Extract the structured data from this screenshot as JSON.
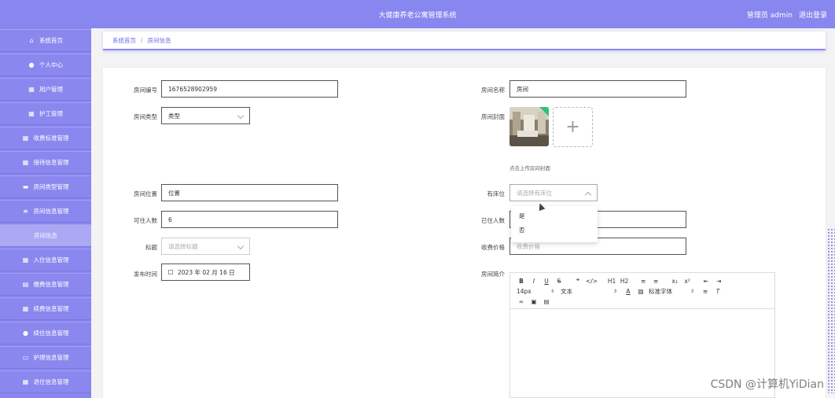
{
  "app": {
    "title": "大健康养老公寓管理系统",
    "user_label": "管理员 admin",
    "logout_label": "退出登录"
  },
  "sidebar": {
    "items": [
      {
        "label": "系统首页",
        "icon": "home-icon"
      },
      {
        "label": "个人中心",
        "icon": "user-icon"
      },
      {
        "label": "用户管理",
        "icon": "grid-icon"
      },
      {
        "label": "护工管理",
        "icon": "grid-icon"
      },
      {
        "label": "收费标准管理",
        "icon": "grid-icon"
      },
      {
        "label": "接待信息管理",
        "icon": "grid-icon"
      },
      {
        "label": "房间类型管理",
        "icon": "bag-icon"
      },
      {
        "label": "房间信息管理",
        "icon": "list-icon"
      },
      {
        "label": "房间信息",
        "icon": ""
      },
      {
        "label": "入住信息管理",
        "icon": "grid-icon"
      },
      {
        "label": "缴费信息管理",
        "icon": "table-icon"
      },
      {
        "label": "续费信息管理",
        "icon": "grid-icon"
      },
      {
        "label": "续住信息管理",
        "icon": "user-icon"
      },
      {
        "label": "护理信息管理",
        "icon": "monitor-icon"
      },
      {
        "label": "退住信息管理",
        "icon": "grid-icon"
      }
    ]
  },
  "breadcrumb": {
    "home": "系统首页",
    "separator": "/",
    "current": "房间信息"
  },
  "form": {
    "room_no": {
      "label": "房间编号",
      "value": "1676528902959"
    },
    "room_name": {
      "label": "房间名称",
      "value": "房间"
    },
    "room_type": {
      "label": "房间类型",
      "value": "类型"
    },
    "cover": {
      "label": "房间封面",
      "hint": "点击上传房间封面"
    },
    "location": {
      "label": "房间位置",
      "value": "位置"
    },
    "has_bed": {
      "label": "有床位",
      "placeholder": "请选择有床位",
      "options": [
        "是",
        "否"
      ]
    },
    "capacity": {
      "label": "可住人数",
      "value": "6"
    },
    "occupied": {
      "label": "已住人数",
      "value": ""
    },
    "tag": {
      "label": "标题",
      "placeholder": "请选择标题"
    },
    "price": {
      "label": "收费价格",
      "placeholder": "收费价格"
    },
    "publish_time": {
      "label": "发布时间",
      "value": "2023 年 02 月 16 日"
    },
    "intro": {
      "label": "房间简介"
    }
  },
  "editor": {
    "font_size": "14px",
    "block_format": "文本",
    "font_family": "标准字体",
    "buttons": [
      "B",
      "I",
      "U",
      "S",
      "❞",
      "</>",
      "H1",
      "H2",
      "≡",
      "≡",
      "x₂",
      "x²",
      "⇤",
      "⇥"
    ]
  },
  "watermark": "CSDN @计算机YiDian",
  "colors": {
    "primary": "#8886ef",
    "active": "#aba9f3",
    "link": "#6f6de8"
  }
}
